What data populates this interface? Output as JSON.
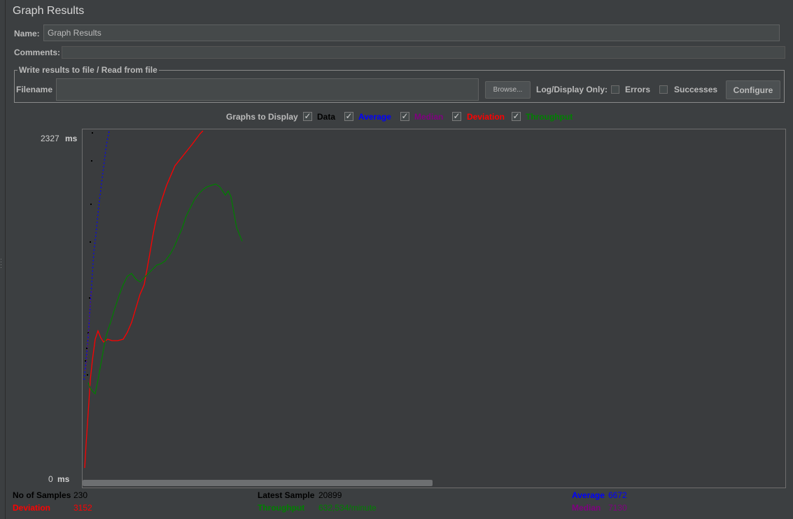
{
  "title": "Graph Results",
  "name_label": "Name:",
  "name_value": "Graph Results",
  "comments_label": "Comments:",
  "file_section_label": "Write results to file / Read from file",
  "filename_label": "Filename",
  "filename_value": "",
  "browse_label": "Browse...",
  "log_display_label": "Log/Display Only:",
  "errors_label": "Errors",
  "successes_label": "Successes",
  "configure_label": "Configure",
  "graphs_label": "Graphs to Display",
  "series": [
    {
      "label": "Data",
      "color": "#000000",
      "checked": true
    },
    {
      "label": "Average",
      "color": "#0000ff",
      "checked": true
    },
    {
      "label": "Median",
      "color": "#800080",
      "checked": true
    },
    {
      "label": "Deviation",
      "color": "#ff0000",
      "checked": true
    },
    {
      "label": "Throughput",
      "color": "#008000",
      "checked": true
    }
  ],
  "y_axis": {
    "max": "2327",
    "min": "0",
    "unit": "ms"
  },
  "stats": {
    "no_samples_label": "No of Samples",
    "no_samples_value": "230",
    "latest_label": "Latest Sample",
    "latest_value": "20899",
    "average_label": "Average",
    "average_value": "6672",
    "deviation_label": "Deviation",
    "deviation_value": "3152",
    "throughput_label": "Throughput",
    "throughput_value": "632,534/minute",
    "median_label": "Median",
    "median_value": "7130"
  }
}
